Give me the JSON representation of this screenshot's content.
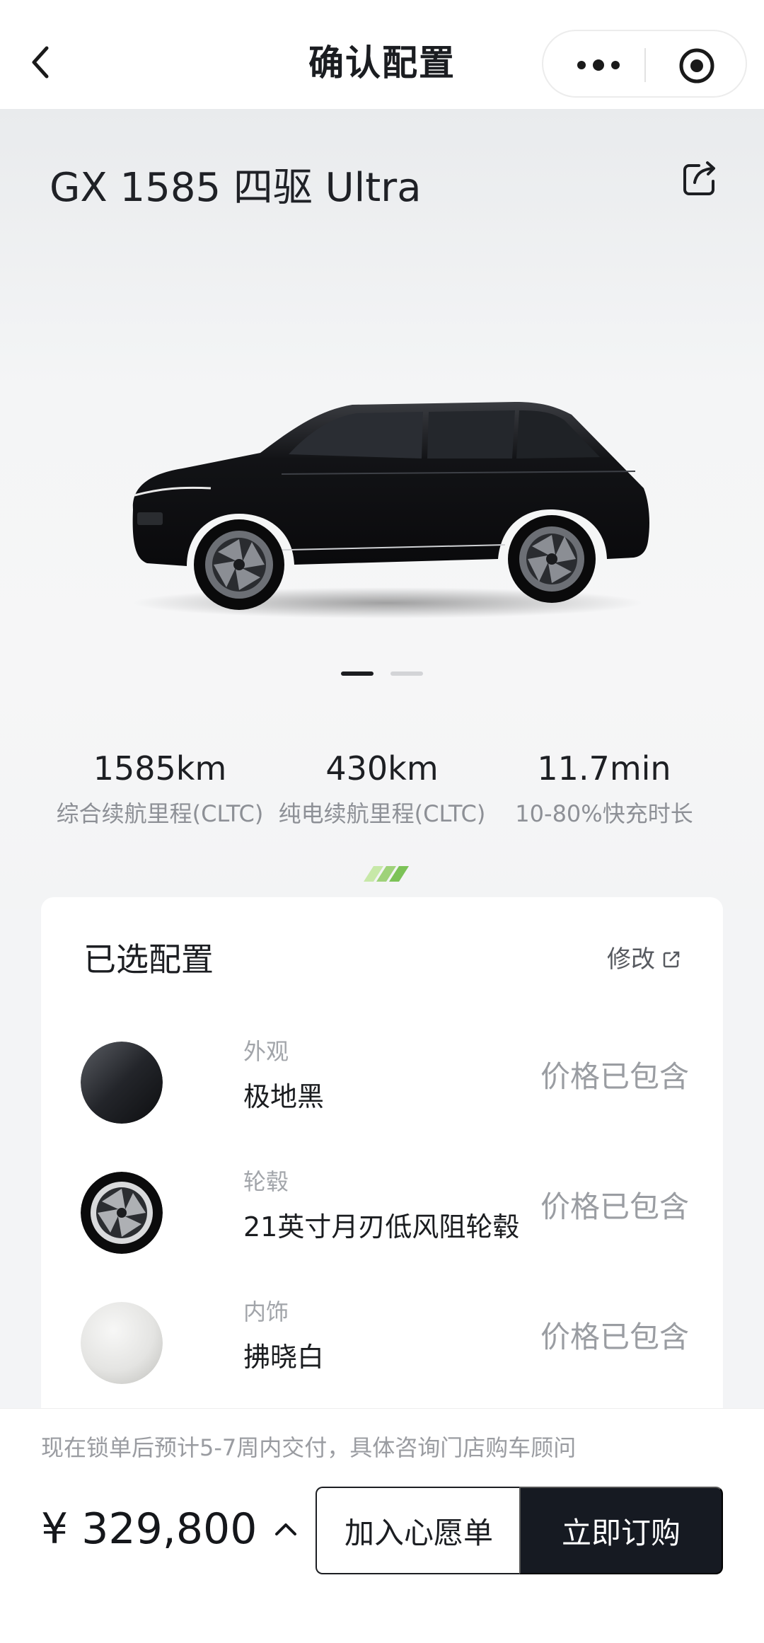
{
  "nav": {
    "title": "确认配置",
    "back_icon": "chevron-left-icon",
    "more_icon": "more-dots-icon",
    "close_icon": "target-circle-icon"
  },
  "hero": {
    "model_name": "GX 1585 四驱 Ultra",
    "share_icon": "share-icon",
    "car_color": "#141518",
    "carousel": {
      "total": 2,
      "active": 1
    },
    "specs": [
      {
        "value": "1585km",
        "label": "综合续航里程(CLTC)"
      },
      {
        "value": "430km",
        "label": "纯电续航里程(CLTC)"
      },
      {
        "value": "11.7min",
        "label": "10-80%快充时长"
      }
    ]
  },
  "config": {
    "title": "已选配置",
    "modify_label": "修改",
    "modify_icon": "external-link-icon",
    "items": [
      {
        "category": "外观",
        "name": "极地黑",
        "price_note": "价格已包含",
        "thumb": "black-paint-swatch"
      },
      {
        "category": "轮毂",
        "name": "21英寸月刃低风阻轮毂",
        "price_note": "价格已包含",
        "thumb": "wheel-rim"
      },
      {
        "category": "内饰",
        "name": "拂晓白",
        "price_note": "价格已包含",
        "thumb": "white-leather-swatch"
      }
    ]
  },
  "bottom": {
    "notice": "现在锁单后预计5-7周内交付，具体咨询门店购车顾问",
    "price": "¥ 329,800",
    "price_toggle_icon": "chevron-up-icon",
    "wishlist_label": "加入心愿单",
    "order_label": "立即订购",
    "order_bg": "#161a22"
  }
}
